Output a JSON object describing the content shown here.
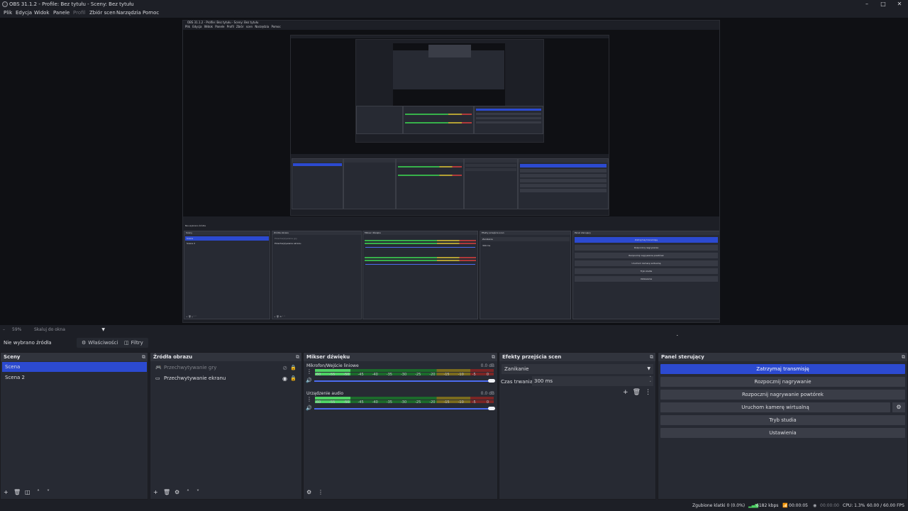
{
  "window": {
    "title": "OBS 31.1.2 - Profile: Bez tytułu - Sceny: Bez tytułu",
    "minimize": "–",
    "maximize": "□",
    "close": "✕"
  },
  "menu": [
    "Plik",
    "Edycja",
    "Widok",
    "Panele",
    "Profil",
    "Zbiór scen",
    "Narzędzia",
    "Pomoc"
  ],
  "zoom": {
    "dash": "–",
    "value": "59%",
    "fit_label": "Skaluj do okna"
  },
  "source_toolbar": {
    "no_source": "Nie wybrano źródła",
    "properties": "Właściwości",
    "filters": "Filtry"
  },
  "scenes": {
    "title": "Sceny",
    "items": [
      "Scena",
      "Scena 2"
    ],
    "selected": 0
  },
  "sources": {
    "title": "Źródła obrazu",
    "items": [
      {
        "name": "Przechwytywanie gry",
        "icon": "gamepad-icon",
        "visible": false
      },
      {
        "name": "Przechwytywanie ekranu",
        "icon": "monitor-icon",
        "visible": true
      }
    ]
  },
  "mixer": {
    "title": "Mikser dźwięku",
    "channels": [
      {
        "name": "Mikrofon/Wejście liniowe",
        "db": "0.0 dB",
        "level": 0.2
      },
      {
        "name": "Urządzenie audio",
        "db": "0.0 dB",
        "level": 0.2
      }
    ],
    "ticks": [
      "-60",
      "-55",
      "-50",
      "-45",
      "-40",
      "-35",
      "-30",
      "-25",
      "-20",
      "-15",
      "-10",
      "-5",
      "0"
    ]
  },
  "transitions": {
    "title": "Efekty przejścia scen",
    "selected": "Zanikanie",
    "duration_label": "Czas trwania",
    "duration_value": "300 ms"
  },
  "controls": {
    "title": "Panel sterujący",
    "buttons": [
      {
        "label": "Zatrzymaj transmisję",
        "active": true
      },
      {
        "label": "Rozpocznij nagrywanie",
        "active": false
      },
      {
        "label": "Rozpocznij nagrywanie powtórek",
        "active": false
      },
      {
        "label": "Uruchom kamerę wirtualną",
        "active": false
      },
      {
        "label": "Tryb studia",
        "active": false
      },
      {
        "label": "Ustawienia",
        "active": false
      }
    ]
  },
  "status": {
    "dropped": "Zgubione klatki 0 (0.0%)",
    "bitrate": "6182 kbps",
    "stream_time": "00:00:05",
    "rec_time": "00:00:00",
    "cpu": "CPU: 1.3%",
    "fps": "60.00 / 60.00 FPS"
  },
  "colors": {
    "accent": "#2c4ad0",
    "background": "#1d1f26",
    "panel": "#272a33",
    "meter_green": "#4ed364"
  }
}
